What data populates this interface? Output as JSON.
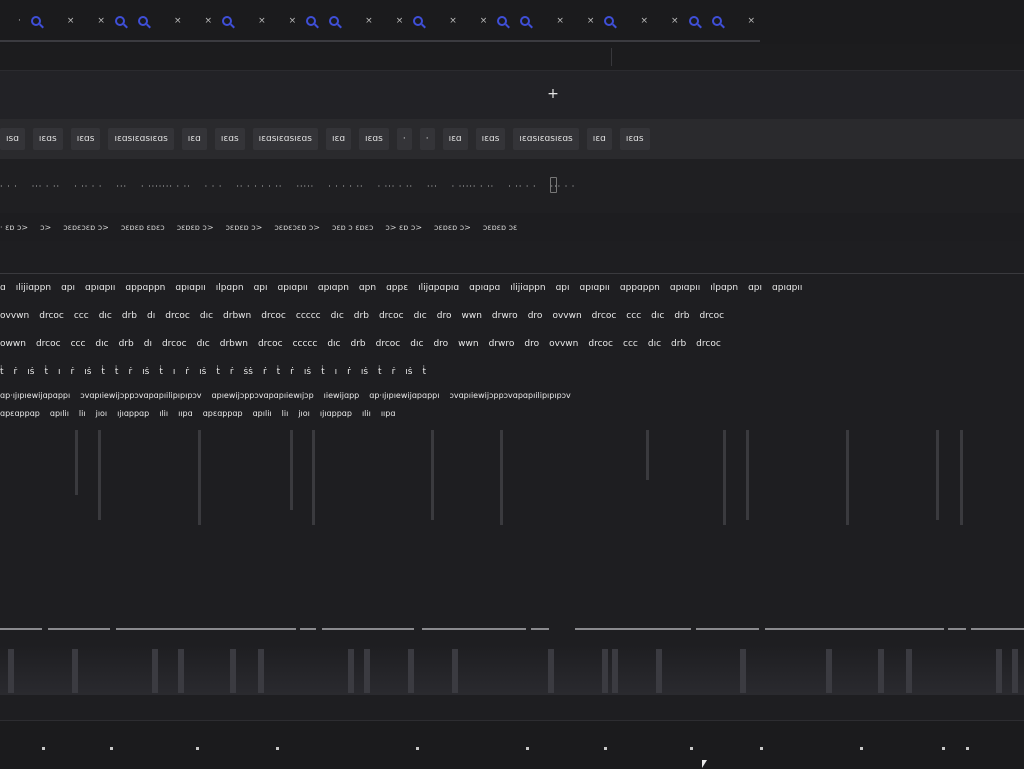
{
  "tabs": [
    {
      "label": "·",
      "icon": "close-icon"
    },
    {
      "label": "",
      "icon": "search-icon"
    },
    {
      "label": "×",
      "icon": "close-icon"
    },
    {
      "label": "×",
      "icon": "close-icon"
    },
    {
      "label": "",
      "icon": "search-icon"
    },
    {
      "label": "",
      "icon": "search-icon"
    },
    {
      "label": "×",
      "icon": "close-icon"
    },
    {
      "label": "×",
      "icon": "close-icon"
    },
    {
      "label": "",
      "icon": "search-icon"
    },
    {
      "label": "×",
      "icon": "close-icon"
    },
    {
      "label": "×",
      "icon": "close-icon"
    },
    {
      "label": "",
      "icon": "search-icon"
    },
    {
      "label": "",
      "icon": "search-icon"
    },
    {
      "label": "×",
      "icon": "close-icon"
    },
    {
      "label": "×",
      "icon": "close-icon"
    },
    {
      "label": "",
      "icon": "search-icon"
    },
    {
      "label": "×",
      "icon": "close-icon"
    },
    {
      "label": "×",
      "icon": "close-icon"
    },
    {
      "label": "",
      "icon": "search-icon"
    },
    {
      "label": "",
      "icon": "search-icon"
    },
    {
      "label": "×",
      "icon": "close-icon"
    },
    {
      "label": "×",
      "icon": "close-icon"
    },
    {
      "label": "",
      "icon": "search-icon"
    },
    {
      "label": "×",
      "icon": "close-icon"
    },
    {
      "label": "×",
      "icon": "close-icon"
    },
    {
      "label": "",
      "icon": "search-icon"
    },
    {
      "label": "",
      "icon": "search-icon"
    },
    {
      "label": "×",
      "icon": "close-icon"
    }
  ],
  "addbar": {
    "add_label": "+"
  },
  "filter_chips": [
    "ısɑ",
    "ıɛɑs",
    "ıɛɑs",
    "ıɛɑsıɛɑsıɛɑs",
    "ıɛɑ",
    "ıɛɑs",
    "ıɛɑsıɛɑsıɛɑs",
    "ıɛɑ",
    "ıɛɑs",
    "·",
    "·",
    "ıɛɑ",
    "ıɛɑs",
    "ıɛɑsıɛɑsıɛɑs",
    "ıɛɑ",
    "ıɛɑs"
  ],
  "header_cols": [
    "·  ·  ·",
    "···  ·  ··",
    "·  ··  ·  ·",
    "···",
    "·  ·······  ·  ··",
    "·  ·  ·",
    "··  ·  ·  ·  ·  ··",
    "·····",
    "·  ·  ·  ·  ··",
    "·  ···  ·  ··",
    "···",
    "·  ·····  ·  ··",
    "·  ··  ·  ·",
    "···  ·  ·"
  ],
  "sub_cols": [
    "·  ɛɒ  ɔ>",
    "ɔ>",
    "ɔɛɒɛɔɛɒ  ɔ>",
    "ɔɛɒɛɒ  ɛɒɛɔ",
    "ɔɛɒɛɒ  ɔ>",
    "ɔɛɒɛɒ  ɔ>",
    "ɔɛɒɛɔɛɒ  ɔ>",
    "ɔɛɒ  ɔ  ɛɒɛɔ",
    "ɔ>  ɛɒ  ɔ>",
    "ɔɛɒɛɒ  ɔ>",
    "ɔɛɒɛɒ  ɔɛ"
  ],
  "rows": [
    {
      "cells": [
        "ɑ",
        "ılijiɑppn",
        "ɑpı",
        "ɑpıɑpıı",
        "ɑppɑppn",
        "ɑpıɑpıı",
        "ılpɑpn",
        "ɑpı",
        "ɑpıɑpıı",
        "ɑpıɑpn",
        "ɑpn",
        "ɑppɛ",
        "ılijɑpɑpıɑ",
        "ɑpıɑpɑ",
        "ılijiɑppn",
        "ɑpı",
        "ɑpıɑpıı",
        "ɑppɑppn",
        "ɑpıɑpıı",
        "ılpɑpn",
        "ɑpı",
        "ɑpıɑpıı"
      ]
    },
    {
      "cells": [
        "ovvwn",
        "drcoc",
        "ccc",
        "dıc",
        "drb",
        "dı",
        "drcoc",
        "dıc",
        "drbwn",
        "drcoc",
        "ccccc",
        "dıc",
        "drb",
        "drcoc",
        "dıc",
        "dro",
        "wwn",
        "drwro",
        "dro",
        "ovvwn",
        "drcoc",
        "ccc",
        "dıc",
        "drb",
        "drcoc"
      ]
    },
    {
      "cells": [
        "owwn",
        "drcoc",
        "ccc",
        "dıc",
        "drb",
        "dı",
        "drcoc",
        "dıc",
        "drbwn",
        "drcoc",
        "ccccc",
        "dıc",
        "drb",
        "drcoc",
        "dıc",
        "dro",
        "wwn",
        "drwro",
        "dro",
        "ovvwn",
        "drcoc",
        "ccc",
        "dıc",
        "drb",
        "drcoc"
      ]
    },
    {
      "cells": [
        "ṫ",
        "ṙ",
        "ıṡ",
        "ṫ",
        "ı",
        "ṙ",
        "ıṡ",
        "ṫ",
        "ṫ",
        "ṙ",
        "ıṡ",
        "ṫ",
        "ı",
        "ṙ",
        "ıṡ",
        "ṫ",
        "ṙ",
        "ṡṡ",
        "ṙ",
        "ṫ",
        "ṙ",
        "ıṡ",
        "ṫ",
        "ı",
        "ṙ",
        "ıṡ",
        "ṫ",
        "ṙ",
        "ıṡ",
        "ṫ"
      ]
    },
    {
      "cells": [
        "ɑp·ıjıpıewijɑpɑppı",
        "ɔvɑpıiewijɔppɔvɑpɑpıilipıpıpɔv",
        "ɑpıewijɔppɔvɑpɑpıiewıjɔp",
        "ıiewijɑpp",
        "ɑp·ıjıpıewijɑpɑppı",
        "ɔvɑpıiewijɔppɔvɑpɑpıilipıpıpɔv"
      ]
    },
    {
      "cells": [
        "ɑpɛɑppɑp",
        "ɑpıliı",
        "liı",
        "jıoı",
        "ıjıɑppɑp",
        "ıliı",
        "ııpɑ",
        "ɑpɛɑppɑp",
        "ɑpıliı",
        "liı",
        "jıoı",
        "ıjıɑppɑp",
        "ıliı",
        "ııpɑ"
      ]
    }
  ],
  "colors": {
    "background": "#1e1e21",
    "accent": "#3f4fd8",
    "text": "#d6d6d6"
  }
}
